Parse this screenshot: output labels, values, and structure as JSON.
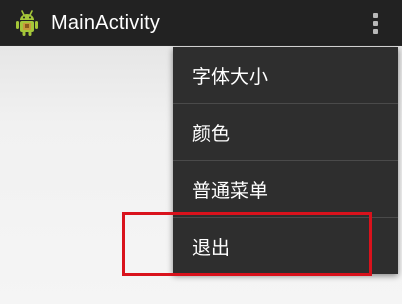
{
  "action_bar": {
    "title": "MainActivity",
    "app_icon": "android-robot-icon",
    "overflow_icon": "overflow-menu-icon"
  },
  "overflow_menu": {
    "items": [
      {
        "label": "字体大小"
      },
      {
        "label": "颜色"
      },
      {
        "label": "普通菜单"
      },
      {
        "label": "退出"
      }
    ]
  },
  "annotation": {
    "highlighted_item": "退出",
    "color": "#d9121c"
  },
  "colors": {
    "action_bar_background": "#222222",
    "menu_background": "#2e2e2e",
    "menu_text": "#ffffff",
    "content_background": "#f2f2f2"
  }
}
